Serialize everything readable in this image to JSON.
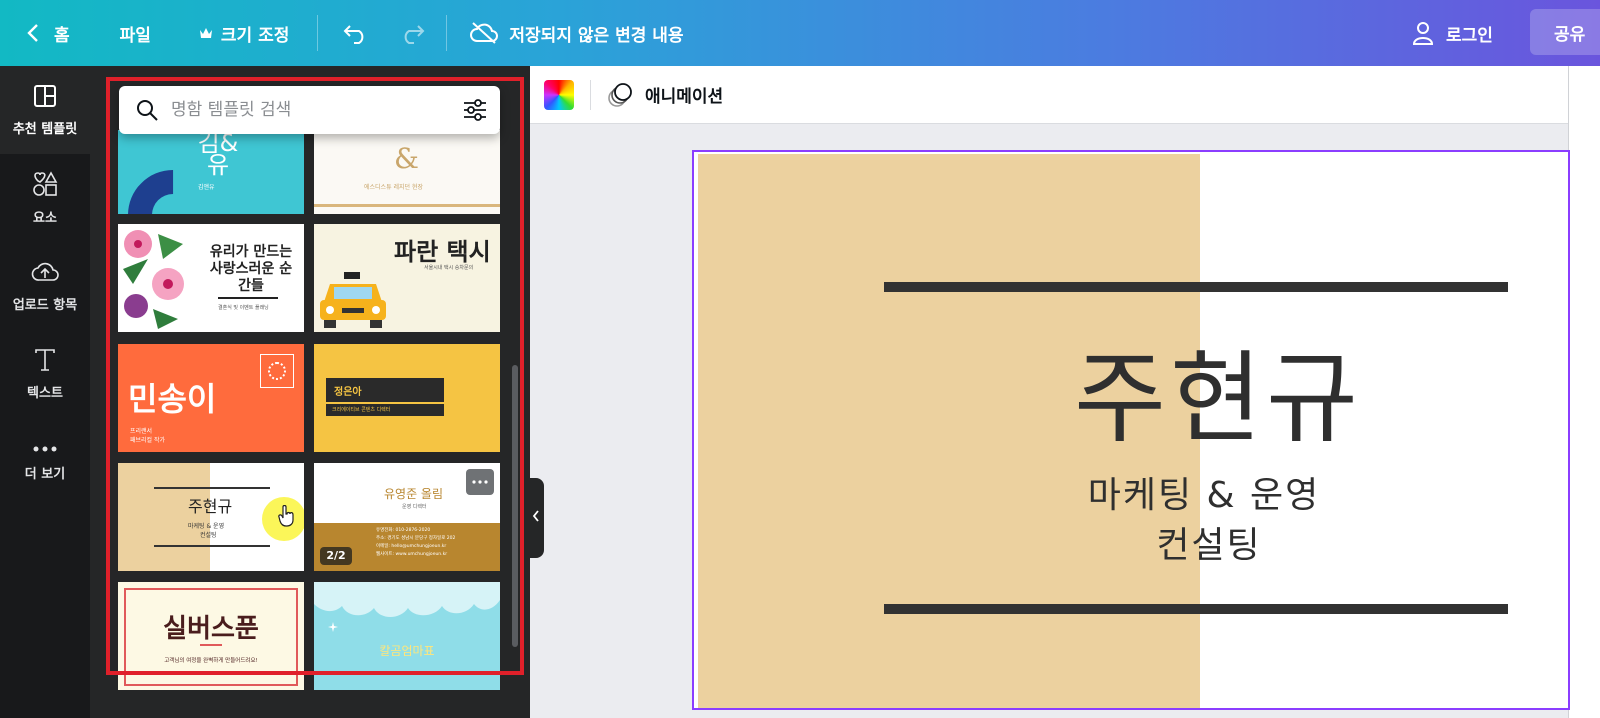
{
  "topbar": {
    "home_label": "홈",
    "file_label": "파일",
    "resize_label": "크기 조정",
    "save_status": "저장되지 않은 변경 내용",
    "login_label": "로그인",
    "share_label": "공유"
  },
  "rail": {
    "items": [
      {
        "label": "추천 템플릿",
        "icon": "template-icon"
      },
      {
        "label": "요소",
        "icon": "elements-icon"
      },
      {
        "label": "업로드 항목",
        "icon": "upload-icon"
      },
      {
        "label": "텍스트",
        "icon": "text-icon"
      },
      {
        "label": "더 보기",
        "icon": "more-icon"
      }
    ]
  },
  "search": {
    "placeholder": "명함 템플릿 검색"
  },
  "templates": {
    "t1_name": "김&유",
    "t1_small": "김앤유",
    "t2_mark": "&",
    "t2_small": "에스디스튜 레지던 현장",
    "t3_title": "유리가 만드는 사랑스러운 순간들",
    "t3_small": "결혼식 및 이벤트 플래닝",
    "t4_title": "파란 택시",
    "t4_small": "서울시내 택시 승차문의",
    "t5_title": "민송이",
    "t5_small1": "프리랜서",
    "t5_small2": "패브리컬 작가",
    "t6_title": "정은아",
    "t6_small": "크리에이티브 콘텐츠 디렉터",
    "t7_title": "주현규",
    "t7_small1": "마케팅 & 운영",
    "t7_small2": "컨설팅",
    "t8_title": "유영준 올림",
    "t8_small": "운영 디렉터",
    "t8_info": [
      "유명전화: 010-2876-2020",
      "주소: 경기도 성남시 분당구 정자일로 202",
      "이메일: hello@umchungjoeun.kr",
      "웹사이트: www.umchungjoeun.kr"
    ],
    "t8_page": "2/2",
    "t9_title": "실버스푼",
    "t9_small": "고객님의 여정을 완벽하게 만들어드려요!",
    "t10_title": "칼곰엄마표"
  },
  "subbar": {
    "animation_label": "애니메이션"
  },
  "design": {
    "name": "주현규",
    "line1": "마케팅 & 운영",
    "line2": "컨설팅"
  },
  "colors": {
    "accent_purple": "#8b3dff",
    "tan": "#ecd19f",
    "highlight_red": "#e0202a"
  }
}
